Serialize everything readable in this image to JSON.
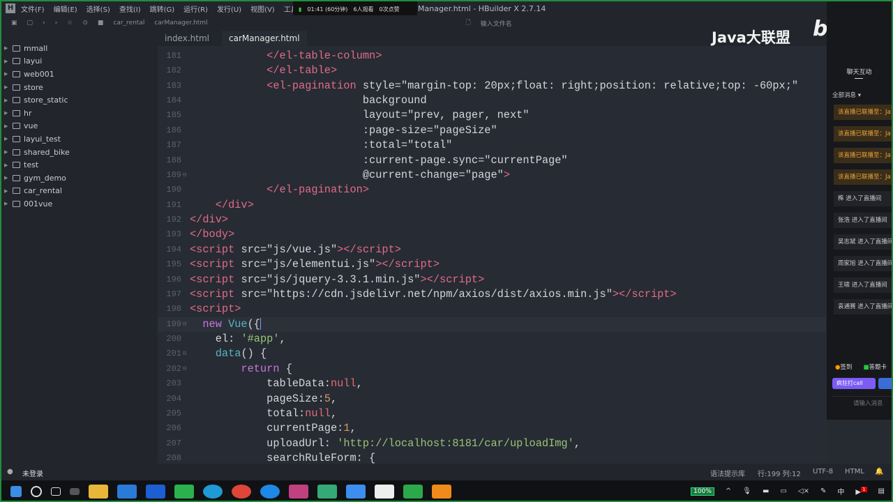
{
  "menu": [
    "文件(F)",
    "编辑(E)",
    "选择(S)",
    "查找(I)",
    "跳转(G)",
    "运行(R)",
    "发行(U)",
    "视图(V)",
    "工具(T"
  ],
  "window_title": "Manager.html - HBuilder X 2.7.14",
  "stream": {
    "time": "01:41 (60分钟)",
    "viewers": "6人观看",
    "likes": "0次点赞"
  },
  "breadcrumb": [
    "car_rental",
    "carManager.html"
  ],
  "file_search_placeholder": "输入文件名",
  "tabs": [
    {
      "label": "index.html"
    },
    {
      "label": "carManager.html",
      "active": true
    }
  ],
  "projects": [
    "mmall",
    "layui",
    "web001",
    "store",
    "store_static",
    "hr",
    "vue",
    "layui_test",
    "shared_bike",
    "test",
    "gym_demo",
    "car_rental",
    "001vue"
  ],
  "code": [
    {
      "n": "181",
      "t": [
        [
          "plain",
          "            "
        ],
        [
          "tag",
          "</el-table-column>"
        ]
      ]
    },
    {
      "n": "182",
      "t": [
        [
          "plain",
          "            "
        ],
        [
          "tag",
          "</el-table>"
        ]
      ]
    },
    {
      "n": "183",
      "t": [
        [
          "plain",
          "            "
        ],
        [
          "tag",
          "<el-pagination"
        ],
        [
          "attr",
          " style="
        ],
        [
          "str",
          "\"margin-top: 20px;float: right;position: relative;top: -60px;\""
        ]
      ]
    },
    {
      "n": "184",
      "t": [
        [
          "attr",
          "                           background"
        ]
      ]
    },
    {
      "n": "185",
      "t": [
        [
          "attr",
          "                           layout="
        ],
        [
          "str",
          "\"prev, pager, next\""
        ]
      ]
    },
    {
      "n": "186",
      "t": [
        [
          "attr",
          "                           :page-size="
        ],
        [
          "str",
          "\"pageSize\""
        ]
      ]
    },
    {
      "n": "187",
      "t": [
        [
          "attr",
          "                           :total="
        ],
        [
          "str",
          "\"total\""
        ]
      ]
    },
    {
      "n": "188",
      "t": [
        [
          "attr",
          "                           :current-page.sync="
        ],
        [
          "str",
          "\"currentPage\""
        ]
      ]
    },
    {
      "n": "189",
      "f": true,
      "t": [
        [
          "attr",
          "                           @current-change="
        ],
        [
          "str",
          "\"page\""
        ],
        [
          "tag",
          ">"
        ]
      ]
    },
    {
      "n": "190",
      "t": [
        [
          "plain",
          "            "
        ],
        [
          "tag",
          "</el-pagination>"
        ]
      ]
    },
    {
      "n": "191",
      "t": [
        [
          "plain",
          "    "
        ],
        [
          "tag",
          "</div>"
        ]
      ]
    },
    {
      "n": "192",
      "t": [
        [
          "tag",
          "</div>"
        ]
      ]
    },
    {
      "n": "193",
      "t": [
        [
          "tag",
          "</body>"
        ]
      ]
    },
    {
      "n": "194",
      "t": [
        [
          "tag",
          "<script"
        ],
        [
          "attr",
          " src="
        ],
        [
          "str",
          "\"js/vue.js\""
        ],
        [
          "tag",
          "></script>"
        ]
      ]
    },
    {
      "n": "195",
      "t": [
        [
          "tag",
          "<script"
        ],
        [
          "attr",
          " src="
        ],
        [
          "str",
          "\"js/elementui.js\""
        ],
        [
          "tag",
          "></script>"
        ]
      ]
    },
    {
      "n": "196",
      "t": [
        [
          "tag",
          "<script"
        ],
        [
          "attr",
          " src="
        ],
        [
          "str",
          "\"js/jquery-3.3.1.min.js\""
        ],
        [
          "tag",
          "></script>"
        ]
      ]
    },
    {
      "n": "197",
      "t": [
        [
          "tag",
          "<script"
        ],
        [
          "attr",
          " src="
        ],
        [
          "str",
          "\"https://cdn.jsdelivr.net/npm/axios/dist/axios.min.js\""
        ],
        [
          "tag",
          "></script>"
        ]
      ]
    },
    {
      "n": "198",
      "t": [
        [
          "tag",
          "<script>"
        ]
      ]
    },
    {
      "n": "199",
      "f": true,
      "cur": true,
      "t": [
        [
          "plain",
          "  "
        ],
        [
          "kw",
          "new "
        ],
        [
          "fn",
          "Vue"
        ],
        [
          "plain",
          "({"
        ]
      ]
    },
    {
      "n": "200",
      "t": [
        [
          "plain",
          "    el: "
        ],
        [
          "js-str",
          "'#app'"
        ],
        [
          "plain",
          ","
        ]
      ]
    },
    {
      "n": "201",
      "f": true,
      "t": [
        [
          "plain",
          "    "
        ],
        [
          "fn",
          "data"
        ],
        [
          "plain",
          "() {"
        ]
      ]
    },
    {
      "n": "202",
      "f": true,
      "t": [
        [
          "plain",
          "        "
        ],
        [
          "kw",
          "return"
        ],
        [
          "plain",
          " {"
        ]
      ]
    },
    {
      "n": "203",
      "t": [
        [
          "plain",
          "            tableData:"
        ],
        [
          "nul",
          "null"
        ],
        [
          "plain",
          ","
        ]
      ]
    },
    {
      "n": "204",
      "t": [
        [
          "plain",
          "            pageSize:"
        ],
        [
          "num",
          "5"
        ],
        [
          "plain",
          ","
        ]
      ]
    },
    {
      "n": "205",
      "t": [
        [
          "plain",
          "            total:"
        ],
        [
          "nul",
          "null"
        ],
        [
          "plain",
          ","
        ]
      ]
    },
    {
      "n": "206",
      "t": [
        [
          "plain",
          "            currentPage:"
        ],
        [
          "num",
          "1"
        ],
        [
          "plain",
          ","
        ]
      ]
    },
    {
      "n": "207",
      "t": [
        [
          "plain",
          "            uploadUrl: "
        ],
        [
          "js-str",
          "'http://localhost:8181/car/uploadImg'"
        ],
        [
          "plain",
          ","
        ]
      ]
    },
    {
      "n": "208",
      "t": [
        [
          "plain",
          "            searchRuleForm: {"
        ]
      ]
    }
  ],
  "status": {
    "login": "未登录",
    "hint_lib": "语法提示库",
    "position": "行:199  列:12",
    "encoding": "UTF-8",
    "language": "HTML"
  },
  "taskbar": {
    "battery": "100%",
    "ime": "中",
    "notif_count": "1"
  },
  "watermark": {
    "text": "Java大联盟",
    "logo": "bilibili"
  },
  "chat": {
    "title": "聊天互动",
    "filter": "全部消息",
    "messages": [
      {
        "text": "该直播已联播至：Ja",
        "sys": true
      },
      {
        "text": "该直播已联播至：Ja",
        "sys": true
      },
      {
        "text": "该直播已联播至：Ja",
        "sys": true
      },
      {
        "text": "该直播已联播至：Ja",
        "sys": true
      },
      {
        "text": "榫 进入了直播间"
      },
      {
        "text": "张浩 进入了直播间"
      },
      {
        "text": "吴志斌 进入了直播间"
      },
      {
        "text": "周家旭 进入了直播间"
      },
      {
        "text": "王啸 进入了直播间"
      },
      {
        "text": "袁通赛 进入了直播间"
      }
    ],
    "checkin": "签到",
    "card": "答题卡",
    "call": "疯狂打call",
    "input_placeholder": "请输入消息"
  },
  "colors": {
    "editor_bg": "#272b33",
    "tag": "#e06c88",
    "keyword": "#c678dd",
    "accent_green": "#1f8f3a"
  }
}
